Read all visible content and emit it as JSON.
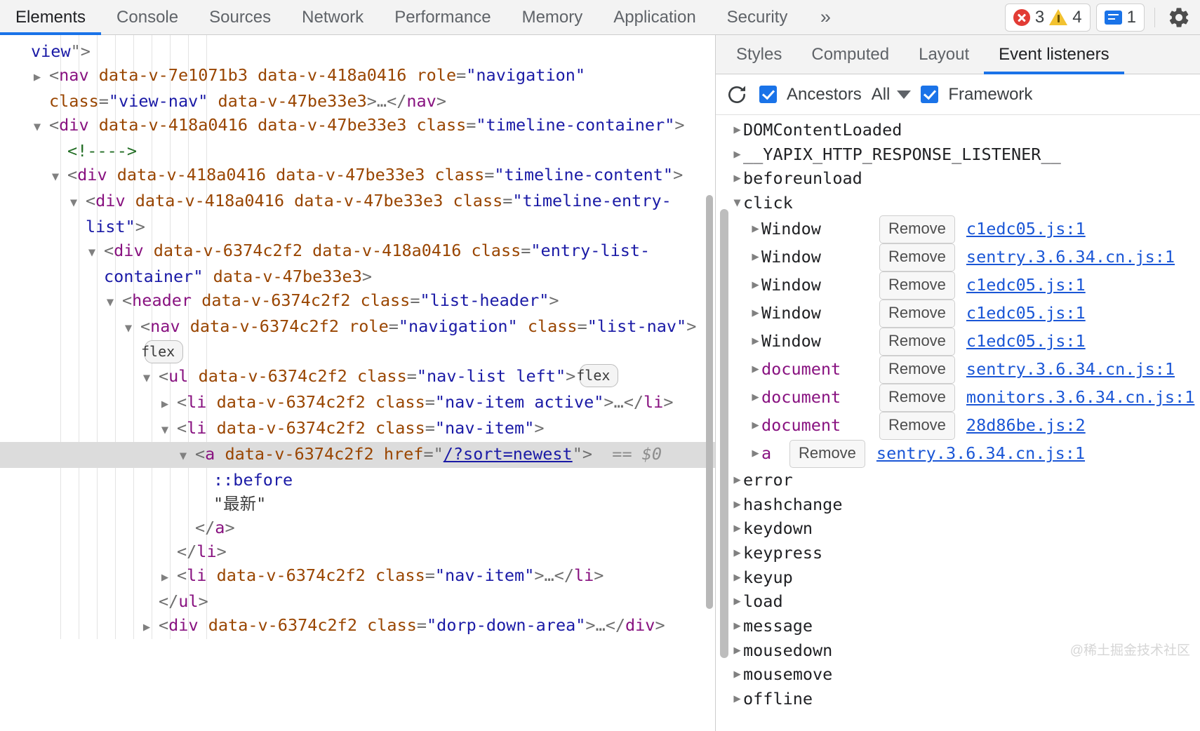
{
  "toolbar": {
    "tabs": [
      {
        "label": "Elements",
        "active": true
      },
      {
        "label": "Console",
        "active": false
      },
      {
        "label": "Sources",
        "active": false
      },
      {
        "label": "Network",
        "active": false
      },
      {
        "label": "Performance",
        "active": false
      },
      {
        "label": "Memory",
        "active": false
      },
      {
        "label": "Application",
        "active": false
      },
      {
        "label": "Security",
        "active": false
      }
    ],
    "more_glyph": "»",
    "error_count": "3",
    "warning_count": "4",
    "message_count": "1",
    "settings_icon": "gear-icon"
  },
  "dom_tree": {
    "lines": [
      {
        "id": "l1",
        "indent": 1,
        "twisty": "none",
        "parts": [
          {
            "t": "val",
            "s": "view"
          },
          {
            "t": "punc",
            "s": "\""
          },
          {
            "t": "punc",
            "s": ">"
          }
        ]
      },
      {
        "id": "l2",
        "indent": 2,
        "twisty": "closed",
        "parts": [
          {
            "t": "punc",
            "s": "<"
          },
          {
            "t": "tag",
            "s": "nav"
          },
          {
            "t": "attr",
            "s": " data-v-7e1071b3"
          },
          {
            "t": "attr",
            "s": " data-v-418a0416"
          },
          {
            "t": "attr",
            "s": " role"
          },
          {
            "t": "punc",
            "s": "="
          },
          {
            "t": "val",
            "s": "\"navigation\""
          },
          {
            "t": "attr",
            "s": " class"
          },
          {
            "t": "punc",
            "s": "="
          },
          {
            "t": "val",
            "s": "\"view-nav\""
          },
          {
            "t": "attr",
            "s": " data-v-47be33e3"
          },
          {
            "t": "punc",
            "s": ">"
          },
          {
            "t": "punc",
            "s": "…"
          },
          {
            "t": "punc",
            "s": "</"
          },
          {
            "t": "tag",
            "s": "nav"
          },
          {
            "t": "punc",
            "s": ">"
          }
        ]
      },
      {
        "id": "l3",
        "indent": 2,
        "twisty": "open",
        "parts": [
          {
            "t": "punc",
            "s": "<"
          },
          {
            "t": "tag",
            "s": "div"
          },
          {
            "t": "attr",
            "s": " data-v-418a0416"
          },
          {
            "t": "attr",
            "s": " data-v-47be33e3"
          },
          {
            "t": "attr",
            "s": " class"
          },
          {
            "t": "punc",
            "s": "="
          },
          {
            "t": "val",
            "s": "\"timeline-container\""
          },
          {
            "t": "punc",
            "s": ">"
          }
        ]
      },
      {
        "id": "l4",
        "indent": 3,
        "twisty": "none",
        "parts": [
          {
            "t": "comment",
            "s": "<!---->"
          }
        ]
      },
      {
        "id": "l5",
        "indent": 3,
        "twisty": "open",
        "parts": [
          {
            "t": "punc",
            "s": "<"
          },
          {
            "t": "tag",
            "s": "div"
          },
          {
            "t": "attr",
            "s": " data-v-418a0416"
          },
          {
            "t": "attr",
            "s": " data-v-47be33e3"
          },
          {
            "t": "attr",
            "s": " class"
          },
          {
            "t": "punc",
            "s": "="
          },
          {
            "t": "val",
            "s": "\"timeline-content\""
          },
          {
            "t": "punc",
            "s": ">"
          }
        ]
      },
      {
        "id": "l6",
        "indent": 4,
        "twisty": "open",
        "parts": [
          {
            "t": "punc",
            "s": "<"
          },
          {
            "t": "tag",
            "s": "div"
          },
          {
            "t": "attr",
            "s": " data-v-418a0416"
          },
          {
            "t": "attr",
            "s": " data-v-47be33e3"
          },
          {
            "t": "attr",
            "s": " class"
          },
          {
            "t": "punc",
            "s": "="
          },
          {
            "t": "val",
            "s": "\"timeline-entry-list\""
          },
          {
            "t": "punc",
            "s": ">"
          }
        ]
      },
      {
        "id": "l7",
        "indent": 5,
        "twisty": "open",
        "parts": [
          {
            "t": "punc",
            "s": "<"
          },
          {
            "t": "tag",
            "s": "div"
          },
          {
            "t": "attr",
            "s": " data-v-6374c2f2"
          },
          {
            "t": "attr",
            "s": " data-v-418a0416"
          },
          {
            "t": "attr",
            "s": " class"
          },
          {
            "t": "punc",
            "s": "="
          },
          {
            "t": "val",
            "s": "\"entry-list-container\""
          },
          {
            "t": "attr",
            "s": " data-v-47be33e3"
          },
          {
            "t": "punc",
            "s": ">"
          }
        ]
      },
      {
        "id": "l8",
        "indent": 6,
        "twisty": "open",
        "parts": [
          {
            "t": "punc",
            "s": "<"
          },
          {
            "t": "tag",
            "s": "header"
          },
          {
            "t": "attr",
            "s": " data-v-6374c2f2"
          },
          {
            "t": "attr",
            "s": " class"
          },
          {
            "t": "punc",
            "s": "="
          },
          {
            "t": "val",
            "s": "\"list-header\""
          },
          {
            "t": "punc",
            "s": ">"
          }
        ]
      },
      {
        "id": "l9",
        "indent": 7,
        "twisty": "open",
        "parts": [
          {
            "t": "punc",
            "s": "<"
          },
          {
            "t": "tag",
            "s": "nav"
          },
          {
            "t": "attr",
            "s": " data-v-6374c2f2"
          },
          {
            "t": "attr",
            "s": " role"
          },
          {
            "t": "punc",
            "s": "="
          },
          {
            "t": "val",
            "s": "\"navigation\""
          },
          {
            "t": "attr",
            "s": " class"
          },
          {
            "t": "punc",
            "s": "="
          },
          {
            "t": "val",
            "s": "\"list-nav\""
          },
          {
            "t": "punc",
            "s": ">"
          },
          {
            "t": "flex",
            "s": "flex"
          }
        ]
      },
      {
        "id": "l10",
        "indent": 8,
        "twisty": "open",
        "parts": [
          {
            "t": "punc",
            "s": "<"
          },
          {
            "t": "tag",
            "s": "ul"
          },
          {
            "t": "attr",
            "s": " data-v-6374c2f2"
          },
          {
            "t": "attr",
            "s": " class"
          },
          {
            "t": "punc",
            "s": "="
          },
          {
            "t": "val",
            "s": "\"nav-list left\""
          },
          {
            "t": "punc",
            "s": ">"
          },
          {
            "t": "flex",
            "s": "flex"
          }
        ]
      },
      {
        "id": "l11",
        "indent": 9,
        "twisty": "closed",
        "parts": [
          {
            "t": "punc",
            "s": "<"
          },
          {
            "t": "tag",
            "s": "li"
          },
          {
            "t": "attr",
            "s": " data-v-6374c2f2"
          },
          {
            "t": "attr",
            "s": " class"
          },
          {
            "t": "punc",
            "s": "="
          },
          {
            "t": "val",
            "s": "\"nav-item active\""
          },
          {
            "t": "punc",
            "s": ">"
          },
          {
            "t": "punc",
            "s": "…"
          },
          {
            "t": "punc",
            "s": "</"
          },
          {
            "t": "tag",
            "s": "li"
          },
          {
            "t": "punc",
            "s": ">"
          }
        ]
      },
      {
        "id": "l12",
        "indent": 9,
        "twisty": "open",
        "parts": [
          {
            "t": "punc",
            "s": "<"
          },
          {
            "t": "tag",
            "s": "li"
          },
          {
            "t": "attr",
            "s": " data-v-6374c2f2"
          },
          {
            "t": "attr",
            "s": " class"
          },
          {
            "t": "punc",
            "s": "="
          },
          {
            "t": "val",
            "s": "\"nav-item\""
          },
          {
            "t": "punc",
            "s": ">"
          }
        ]
      },
      {
        "id": "l13",
        "indent": 10,
        "twisty": "open",
        "selected": true,
        "parts": [
          {
            "t": "punc",
            "s": "<"
          },
          {
            "t": "tag",
            "s": "a"
          },
          {
            "t": "attr",
            "s": " data-v-6374c2f2"
          },
          {
            "t": "attr",
            "s": " href"
          },
          {
            "t": "punc",
            "s": "="
          },
          {
            "t": "punc",
            "s": "\""
          },
          {
            "t": "lnk",
            "s": "/?sort=newest"
          },
          {
            "t": "punc",
            "s": "\""
          },
          {
            "t": "punc",
            "s": ">"
          },
          {
            "t": "eqeq",
            "s": "  == "
          },
          {
            "t": "dollar",
            "s": "$0"
          }
        ]
      },
      {
        "id": "l14",
        "indent": 11,
        "twisty": "none",
        "parts": [
          {
            "t": "pseudo",
            "s": "::before"
          }
        ]
      },
      {
        "id": "l15",
        "indent": 11,
        "twisty": "none",
        "parts": [
          {
            "t": "txtnode",
            "s": "\"最新\""
          }
        ]
      },
      {
        "id": "l16",
        "indent": 10,
        "twisty": "none",
        "parts": [
          {
            "t": "punc",
            "s": "</"
          },
          {
            "t": "tag",
            "s": "a"
          },
          {
            "t": "punc",
            "s": ">"
          }
        ]
      },
      {
        "id": "l17",
        "indent": 9,
        "twisty": "none",
        "parts": [
          {
            "t": "punc",
            "s": "</"
          },
          {
            "t": "tag",
            "s": "li"
          },
          {
            "t": "punc",
            "s": ">"
          }
        ]
      },
      {
        "id": "l18",
        "indent": 9,
        "twisty": "closed",
        "parts": [
          {
            "t": "punc",
            "s": "<"
          },
          {
            "t": "tag",
            "s": "li"
          },
          {
            "t": "attr",
            "s": " data-v-6374c2f2"
          },
          {
            "t": "attr",
            "s": " class"
          },
          {
            "t": "punc",
            "s": "="
          },
          {
            "t": "val",
            "s": "\"nav-item\""
          },
          {
            "t": "punc",
            "s": ">"
          },
          {
            "t": "punc",
            "s": "…"
          },
          {
            "t": "punc",
            "s": "</"
          },
          {
            "t": "tag",
            "s": "li"
          },
          {
            "t": "punc",
            "s": ">"
          }
        ]
      },
      {
        "id": "l19",
        "indent": 8,
        "twisty": "none",
        "parts": [
          {
            "t": "punc",
            "s": "</"
          },
          {
            "t": "tag",
            "s": "ul"
          },
          {
            "t": "punc",
            "s": ">"
          }
        ]
      },
      {
        "id": "l20",
        "indent": 8,
        "twisty": "closed",
        "parts": [
          {
            "t": "punc",
            "s": "<"
          },
          {
            "t": "tag",
            "s": "div"
          },
          {
            "t": "attr",
            "s": " data-v-6374c2f2"
          },
          {
            "t": "attr",
            "s": " class"
          },
          {
            "t": "punc",
            "s": "="
          },
          {
            "t": "val",
            "s": "\"dorp-down-area\""
          },
          {
            "t": "punc",
            "s": ">"
          },
          {
            "t": "punc",
            "s": "…"
          },
          {
            "t": "punc",
            "s": "</"
          },
          {
            "t": "tag",
            "s": "div"
          },
          {
            "t": "punc",
            "s": ">"
          }
        ]
      }
    ]
  },
  "side": {
    "tabs": [
      {
        "label": "Styles",
        "active": false
      },
      {
        "label": "Computed",
        "active": false
      },
      {
        "label": "Layout",
        "active": false
      },
      {
        "label": "Event listeners",
        "active": true
      }
    ],
    "controls": {
      "refresh_icon": "refresh-icon",
      "ancestors_label": "Ancestors",
      "ancestors_checked": true,
      "filter_value": "All",
      "framework_label": "Framework",
      "framework_checked": true
    },
    "events": [
      {
        "name": "DOMContentLoaded",
        "expanded": false,
        "children": []
      },
      {
        "name": "__YAPIX_HTTP_RESPONSE_LISTENER__",
        "expanded": false,
        "children": []
      },
      {
        "name": "beforeunload",
        "expanded": false,
        "children": []
      },
      {
        "name": "click",
        "expanded": true,
        "children": [
          {
            "target": "Window",
            "target_kind": "window",
            "remove_label": "Remove",
            "source": "c1edc05.js:1"
          },
          {
            "target": "Window",
            "target_kind": "window",
            "remove_label": "Remove",
            "source": "sentry.3.6.34.cn.js:1"
          },
          {
            "target": "Window",
            "target_kind": "window",
            "remove_label": "Remove",
            "source": "c1edc05.js:1"
          },
          {
            "target": "Window",
            "target_kind": "window",
            "remove_label": "Remove",
            "source": "c1edc05.js:1"
          },
          {
            "target": "Window",
            "target_kind": "window",
            "remove_label": "Remove",
            "source": "c1edc05.js:1"
          },
          {
            "target": "document",
            "target_kind": "dom",
            "remove_label": "Remove",
            "source": "sentry.3.6.34.cn.js:1"
          },
          {
            "target": "document",
            "target_kind": "dom",
            "remove_label": "Remove",
            "source": "monitors.3.6.34.cn.js:1"
          },
          {
            "target": "document",
            "target_kind": "dom",
            "remove_label": "Remove",
            "source": "28d86be.js:2"
          },
          {
            "target": "a",
            "target_kind": "dom",
            "remove_label": "Remove",
            "source": "sentry.3.6.34.cn.js:1"
          }
        ]
      },
      {
        "name": "error",
        "expanded": false,
        "children": []
      },
      {
        "name": "hashchange",
        "expanded": false,
        "children": []
      },
      {
        "name": "keydown",
        "expanded": false,
        "children": []
      },
      {
        "name": "keypress",
        "expanded": false,
        "children": []
      },
      {
        "name": "keyup",
        "expanded": false,
        "children": []
      },
      {
        "name": "load",
        "expanded": false,
        "children": []
      },
      {
        "name": "message",
        "expanded": false,
        "children": []
      },
      {
        "name": "mousedown",
        "expanded": false,
        "children": []
      },
      {
        "name": "mousemove",
        "expanded": false,
        "children": []
      },
      {
        "name": "offline",
        "expanded": false,
        "children": []
      }
    ]
  },
  "watermark": "@稀土掘金技术社区"
}
